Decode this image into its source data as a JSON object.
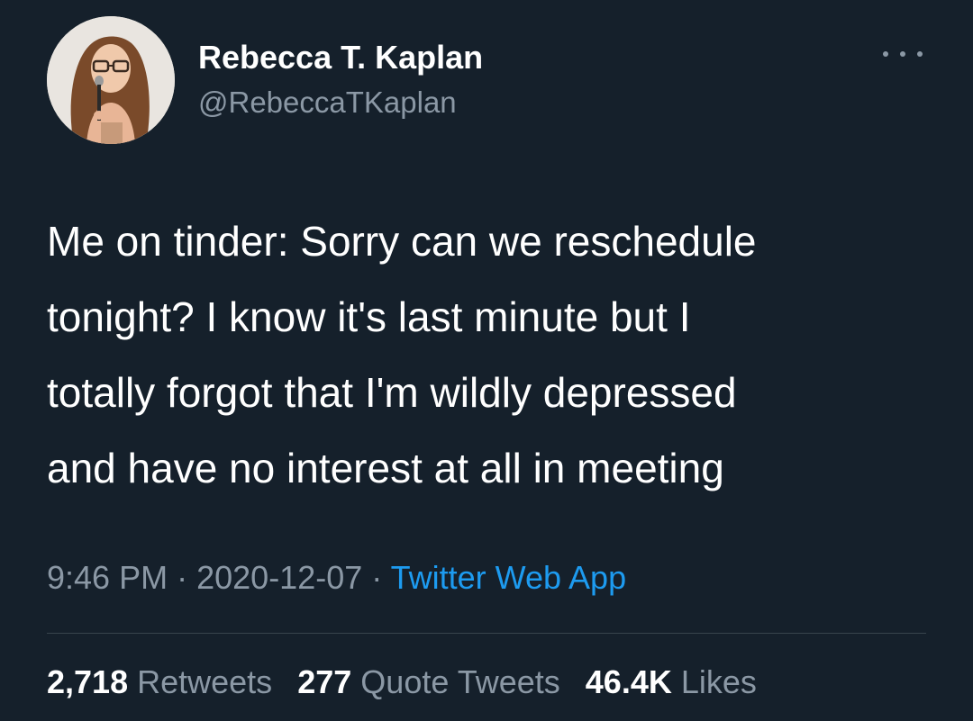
{
  "author": {
    "name": "Rebecca T. Kaplan",
    "handle": "@RebeccaTKaplan"
  },
  "more_icon": "more-horizontal-icon",
  "tweet": {
    "lines": [
      "Me on tinder: Sorry can we reschedule",
      "tonight? I know it's last minute but I",
      "totally forgot that I'm wildly depressed",
      "and have no interest at all in meeting"
    ]
  },
  "meta": {
    "time": "9:46 PM",
    "separator": "·",
    "date": "2020-12-07",
    "source": "Twitter Web App"
  },
  "stats": {
    "retweets": {
      "count": "2,718",
      "label": "Retweets"
    },
    "quotes": {
      "count": "277",
      "label": "Quote Tweets"
    },
    "likes": {
      "count": "46.4K",
      "label": "Likes"
    }
  },
  "colors": {
    "background": "#15202b",
    "text": "#ffffff",
    "secondary": "#8b98a5",
    "link": "#1d9bf0",
    "divider": "#38444d"
  }
}
